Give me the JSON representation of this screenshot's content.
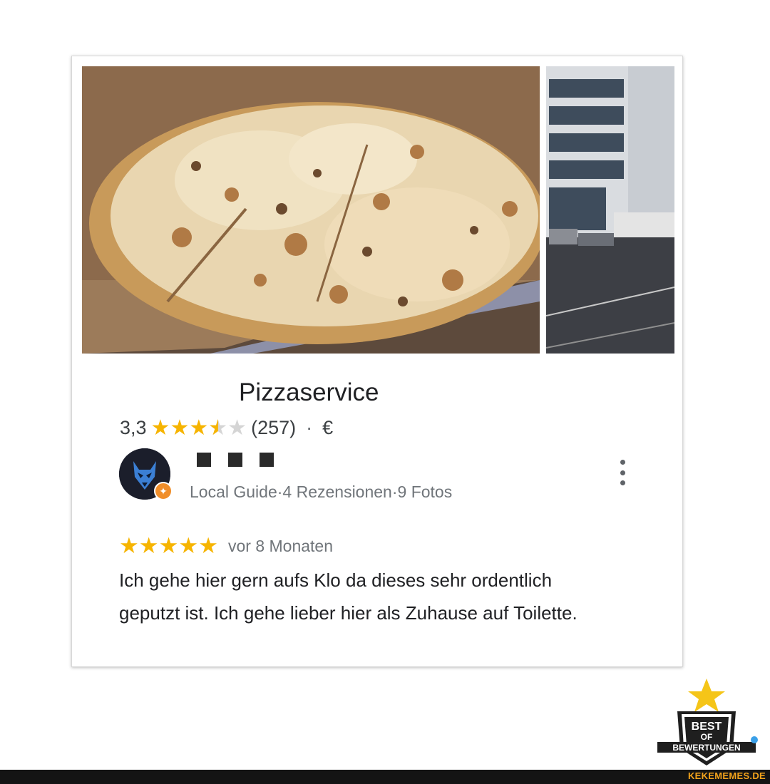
{
  "business": {
    "name": "Pizzaservice",
    "rating": "3,3",
    "rating_value": 3.3,
    "review_count": "(257)",
    "separator": "·",
    "price_level": "€"
  },
  "reviewer": {
    "name_redacted": true,
    "meta": "Local Guide·4 Rezensionen·9 Fotos"
  },
  "review": {
    "stars": 5,
    "time": "vor 8 Monaten",
    "text": "Ich gehe hier gern aufs Klo da dieses sehr ordentlich geputzt ist. Ich gehe lieber hier als Zuhause auf Toilette."
  },
  "watermark": {
    "logo_text": "BEST OF BEWERTUNGEN",
    "site": "KEKEMEMES.DE"
  },
  "icons": {
    "star": "star-icon",
    "menu": "more-vert-icon",
    "badge": "local-guide-badge-icon"
  },
  "colors": {
    "star": "#f6b400",
    "star_empty": "#d5d5d5",
    "footer_text": "#f2a21b",
    "footer_bg": "#141414"
  }
}
